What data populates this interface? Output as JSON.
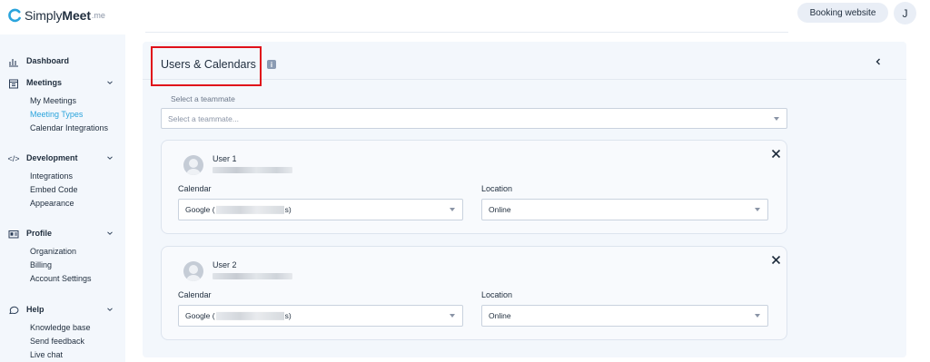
{
  "app": {
    "logo_name": "Simply",
    "logo_bold": "Meet",
    "logo_suffix": ".me",
    "booking_button": "Booking website",
    "avatar_initial": "J"
  },
  "sidebar": {
    "dashboard": "Dashboard",
    "meetings": {
      "label": "Meetings",
      "items": [
        "My Meetings",
        "Meeting Types",
        "Calendar Integrations"
      ],
      "active": "Meeting Types"
    },
    "development": {
      "label": "Development",
      "items": [
        "Integrations",
        "Embed Code",
        "Appearance"
      ]
    },
    "profile": {
      "label": "Profile",
      "items": [
        "Organization",
        "Billing",
        "Account Settings"
      ]
    },
    "help": {
      "label": "Help",
      "items": [
        "Knowledge base",
        "Send feedback",
        "Live chat"
      ]
    }
  },
  "main": {
    "title": "Users & Calendars",
    "info_icon": "i",
    "team_select": {
      "label": "Select a teammate",
      "placeholder": "Select a teammate..."
    },
    "users": [
      {
        "name": "User 1",
        "calendar_label": "Calendar",
        "calendar_prefix": "Google (",
        "calendar_suffix": "s)",
        "location_label": "Location",
        "location_value": "Online"
      },
      {
        "name": "User 2",
        "calendar_label": "Calendar",
        "calendar_prefix": "Google (",
        "calendar_suffix": "s)",
        "location_label": "Location",
        "location_value": "Online"
      }
    ]
  },
  "colors": {
    "accent": "#2aa4dc",
    "highlight": "#e0101a",
    "panel": "#f3f7fc"
  }
}
